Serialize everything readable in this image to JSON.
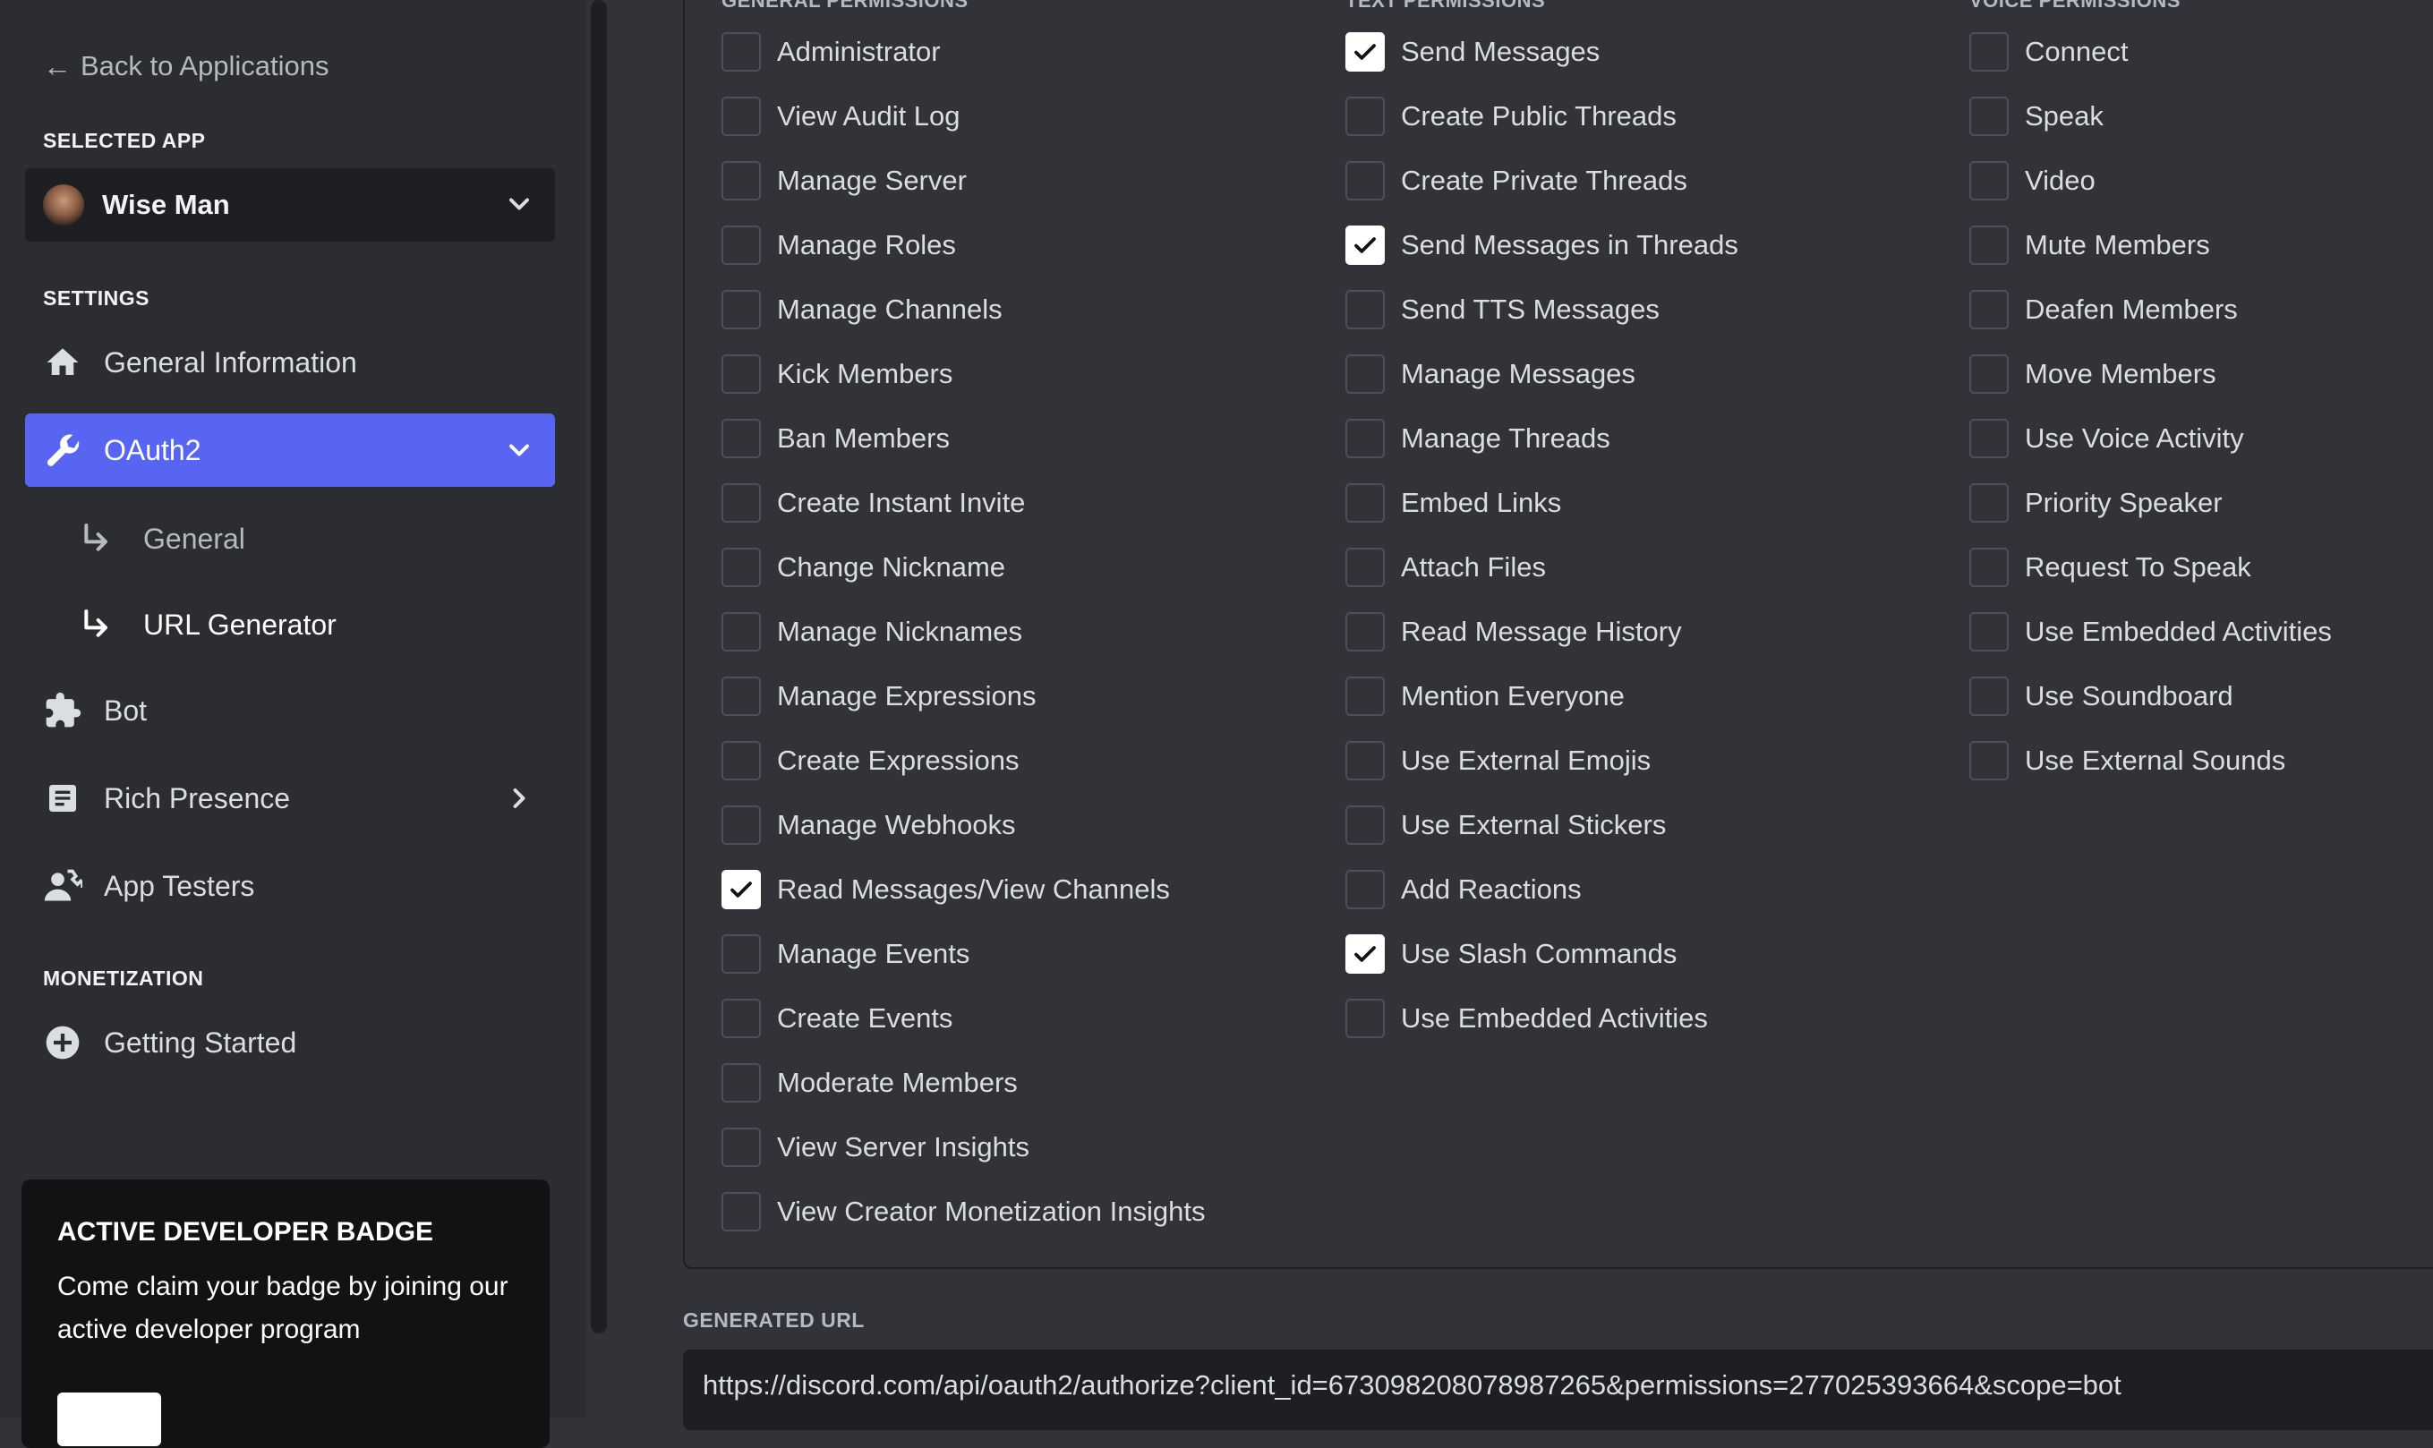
{
  "sidebar": {
    "back_label": "Back to Applications",
    "selected_app_heading": "SELECTED APP",
    "app_name": "Wise Man",
    "settings_heading": "SETTINGS",
    "items": [
      {
        "label": "General Information",
        "icon": "home-icon"
      },
      {
        "label": "OAuth2",
        "icon": "wrench-icon",
        "active": true
      },
      {
        "label": "Bot",
        "icon": "puzzle-icon"
      },
      {
        "label": "Rich Presence",
        "icon": "document-icon"
      },
      {
        "label": "App Testers",
        "icon": "user-phone-icon"
      }
    ],
    "sub_items": [
      {
        "label": "General"
      },
      {
        "label": "URL Generator",
        "active": true
      }
    ],
    "monetization_heading": "MONETIZATION",
    "monetization_item": {
      "label": "Getting Started",
      "icon": "plus-circle-icon"
    },
    "badge_card": {
      "title": "ACTIVE DEVELOPER BADGE",
      "text": "Come claim your badge by joining our active developer program"
    }
  },
  "permissions": {
    "general": {
      "heading": "GENERAL PERMISSIONS",
      "items": [
        {
          "label": "Administrator",
          "checked": false
        },
        {
          "label": "View Audit Log",
          "checked": false
        },
        {
          "label": "Manage Server",
          "checked": false
        },
        {
          "label": "Manage Roles",
          "checked": false
        },
        {
          "label": "Manage Channels",
          "checked": false
        },
        {
          "label": "Kick Members",
          "checked": false
        },
        {
          "label": "Ban Members",
          "checked": false
        },
        {
          "label": "Create Instant Invite",
          "checked": false
        },
        {
          "label": "Change Nickname",
          "checked": false
        },
        {
          "label": "Manage Nicknames",
          "checked": false
        },
        {
          "label": "Manage Expressions",
          "checked": false
        },
        {
          "label": "Create Expressions",
          "checked": false
        },
        {
          "label": "Manage Webhooks",
          "checked": false
        },
        {
          "label": "Read Messages/View Channels",
          "checked": true
        },
        {
          "label": "Manage Events",
          "checked": false
        },
        {
          "label": "Create Events",
          "checked": false
        },
        {
          "label": "Moderate Members",
          "checked": false
        },
        {
          "label": "View Server Insights",
          "checked": false
        },
        {
          "label": "View Creator Monetization Insights",
          "checked": false
        }
      ]
    },
    "text": {
      "heading": "TEXT PERMISSIONS",
      "items": [
        {
          "label": "Send Messages",
          "checked": true
        },
        {
          "label": "Create Public Threads",
          "checked": false
        },
        {
          "label": "Create Private Threads",
          "checked": false
        },
        {
          "label": "Send Messages in Threads",
          "checked": true
        },
        {
          "label": "Send TTS Messages",
          "checked": false
        },
        {
          "label": "Manage Messages",
          "checked": false
        },
        {
          "label": "Manage Threads",
          "checked": false
        },
        {
          "label": "Embed Links",
          "checked": false
        },
        {
          "label": "Attach Files",
          "checked": false
        },
        {
          "label": "Read Message History",
          "checked": false
        },
        {
          "label": "Mention Everyone",
          "checked": false
        },
        {
          "label": "Use External Emojis",
          "checked": false
        },
        {
          "label": "Use External Stickers",
          "checked": false
        },
        {
          "label": "Add Reactions",
          "checked": false
        },
        {
          "label": "Use Slash Commands",
          "checked": true
        },
        {
          "label": "Use Embedded Activities",
          "checked": false
        }
      ]
    },
    "voice": {
      "heading": "VOICE PERMISSIONS",
      "items": [
        {
          "label": "Connect",
          "checked": false
        },
        {
          "label": "Speak",
          "checked": false
        },
        {
          "label": "Video",
          "checked": false
        },
        {
          "label": "Mute Members",
          "checked": false
        },
        {
          "label": "Deafen Members",
          "checked": false
        },
        {
          "label": "Move Members",
          "checked": false
        },
        {
          "label": "Use Voice Activity",
          "checked": false
        },
        {
          "label": "Priority Speaker",
          "checked": false
        },
        {
          "label": "Request To Speak",
          "checked": false
        },
        {
          "label": "Use Embedded Activities",
          "checked": false
        },
        {
          "label": "Use Soundboard",
          "checked": false
        },
        {
          "label": "Use External Sounds",
          "checked": false
        }
      ]
    }
  },
  "generated_url": {
    "heading": "GENERATED URL",
    "value": "https://discord.com/api/oauth2/authorize?client_id=673098208078987265&permissions=277025393664&scope=bot"
  }
}
